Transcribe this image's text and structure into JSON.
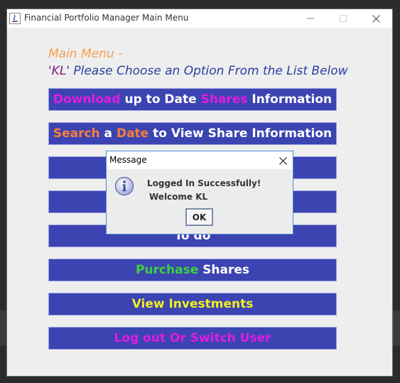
{
  "window": {
    "title": "Financial Portfolio Manager Main Menu",
    "controls": [
      "minimize-icon",
      "maximize-icon",
      "close-icon"
    ]
  },
  "menu": {
    "title": "Main Menu -",
    "subtitle_user": "'KL'",
    "subtitle_text": " Please Choose an Option From the List Below"
  },
  "options": [
    {
      "parts": [
        {
          "text": "Download",
          "color": "#e01ce0"
        },
        {
          "text": " up to Date ",
          "color": "#ffffff"
        },
        {
          "text": "Shares",
          "color": "#e01ce0"
        },
        {
          "text": " Information",
          "color": "#ffffff"
        }
      ]
    },
    {
      "parts": [
        {
          "text": "Search",
          "color": "#f6803a"
        },
        {
          "text": " a ",
          "color": "#ffffff"
        },
        {
          "text": "Date",
          "color": "#f6803a"
        },
        {
          "text": " to View Share Information",
          "color": "#ffffff"
        }
      ]
    },
    {
      "parts": []
    },
    {
      "parts": []
    },
    {
      "parts": [
        {
          "text": "To do",
          "color": "#ffffff"
        }
      ]
    },
    {
      "parts": [
        {
          "text": "Purchase",
          "color": "#3ed13e"
        },
        {
          "text": " Shares",
          "color": "#ffffff"
        }
      ]
    },
    {
      "parts": [
        {
          "text": "View Investments",
          "color": "#f0f020"
        }
      ]
    },
    {
      "parts": [
        {
          "text": "Log out Or Switch User",
          "color": "#e01ce0"
        }
      ]
    }
  ],
  "dialog": {
    "title": "Message",
    "line1": "Logged In Successfully!",
    "line2": "Welcome KL",
    "ok_label": "OK",
    "icon": "info-icon"
  },
  "colors": {
    "button_bg": "#3c44b2",
    "title_orange": "#f6a04d",
    "subtitle_blue": "#2a3fa0"
  }
}
